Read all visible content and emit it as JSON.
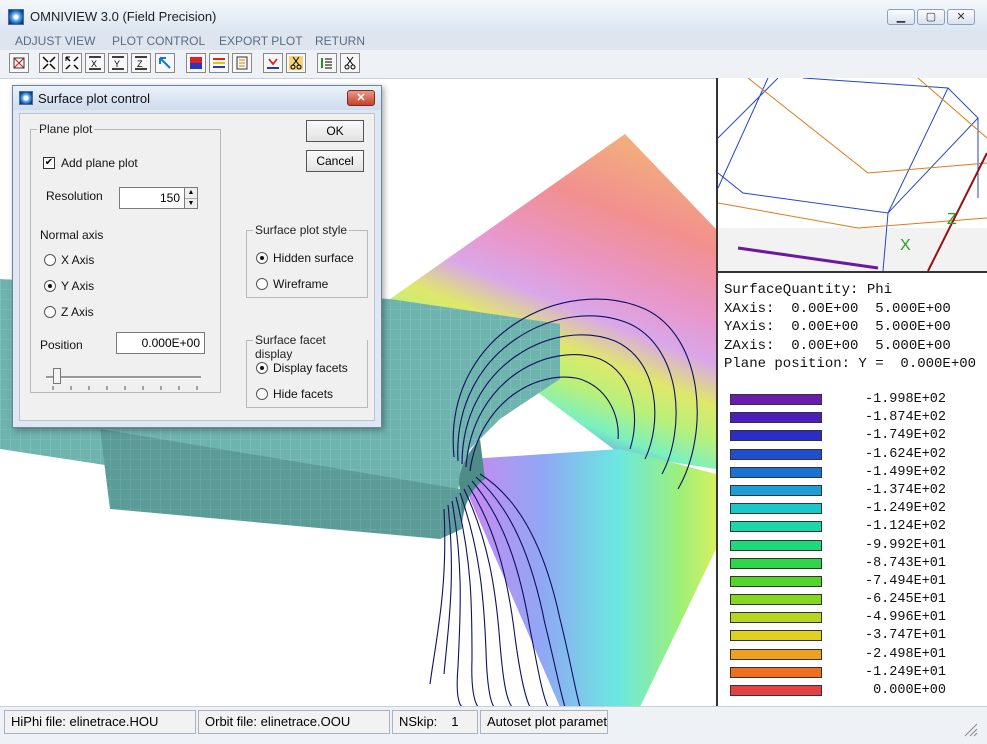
{
  "window": {
    "title": "OMNIVIEW 3.0 (Field Precision)"
  },
  "menu": {
    "items": [
      "ADJUST VIEW",
      "PLOT CONTROL",
      "EXPORT PLOT",
      "RETURN"
    ]
  },
  "info": {
    "surface_quantity": "SurfaceQuantity: Phi",
    "xaxis": "XAxis:  0.00E+00  5.000E+00",
    "yaxis": "YAxis:  0.00E+00  5.000E+00",
    "zaxis": "ZAxis:  0.00E+00  5.000E+00",
    "plane_position": "Plane position: Y =  0.000E+00"
  },
  "orientation": {
    "axis_x": "X",
    "axis_z": "Z"
  },
  "legend": [
    {
      "value": "-1.998E+02",
      "color": "#6a1bb0"
    },
    {
      "value": "-1.874E+02",
      "color": "#4a1fbf"
    },
    {
      "value": "-1.749E+02",
      "color": "#2a2ec6"
    },
    {
      "value": "-1.624E+02",
      "color": "#1f4fd0"
    },
    {
      "value": "-1.499E+02",
      "color": "#1a72d6"
    },
    {
      "value": "-1.374E+02",
      "color": "#1aa0d6"
    },
    {
      "value": "-1.249E+02",
      "color": "#1ac7cc"
    },
    {
      "value": "-1.124E+02",
      "color": "#1ad9a8"
    },
    {
      "value": "-9.992E+01",
      "color": "#20d97a"
    },
    {
      "value": "-8.743E+01",
      "color": "#2fd64a"
    },
    {
      "value": "-7.494E+01",
      "color": "#52d62a"
    },
    {
      "value": "-6.245E+01",
      "color": "#86d620"
    },
    {
      "value": "-4.996E+01",
      "color": "#b6d620"
    },
    {
      "value": "-3.747E+01",
      "color": "#e0d020"
    },
    {
      "value": "-2.498E+01",
      "color": "#f0a020"
    },
    {
      "value": "-1.249E+01",
      "color": "#f07020"
    },
    {
      "value": "0.000E+00",
      "color": "#e84040"
    }
  ],
  "status": {
    "hiphi": "HiPhi file: elinetrace.HOU",
    "orbit": "Orbit file: elinetrace.OOU",
    "nskip_label": "NSkip:",
    "nskip_value": "1",
    "autoset": "Autoset plot paramet"
  },
  "dialog": {
    "title": "Surface plot control",
    "plane_plot": "Plane plot",
    "add_plane_plot": "Add plane plot",
    "add_plane_plot_checked": true,
    "resolution_label": "Resolution",
    "resolution_value": "150",
    "normal_axis": "Normal axis",
    "axis_options": [
      "X Axis",
      "Y Axis",
      "Z Axis"
    ],
    "axis_selected": "Y Axis",
    "position_label": "Position",
    "position_value": "0.000E+00",
    "ok": "OK",
    "cancel": "Cancel",
    "surface_style_title": "Surface plot style",
    "style_options": [
      "Hidden surface",
      "Wireframe"
    ],
    "style_selected": "Hidden surface",
    "facet_title": "Surface facet display",
    "facet_options": [
      "Display facets",
      "Hide facets"
    ],
    "facet_selected": "Display facets"
  }
}
